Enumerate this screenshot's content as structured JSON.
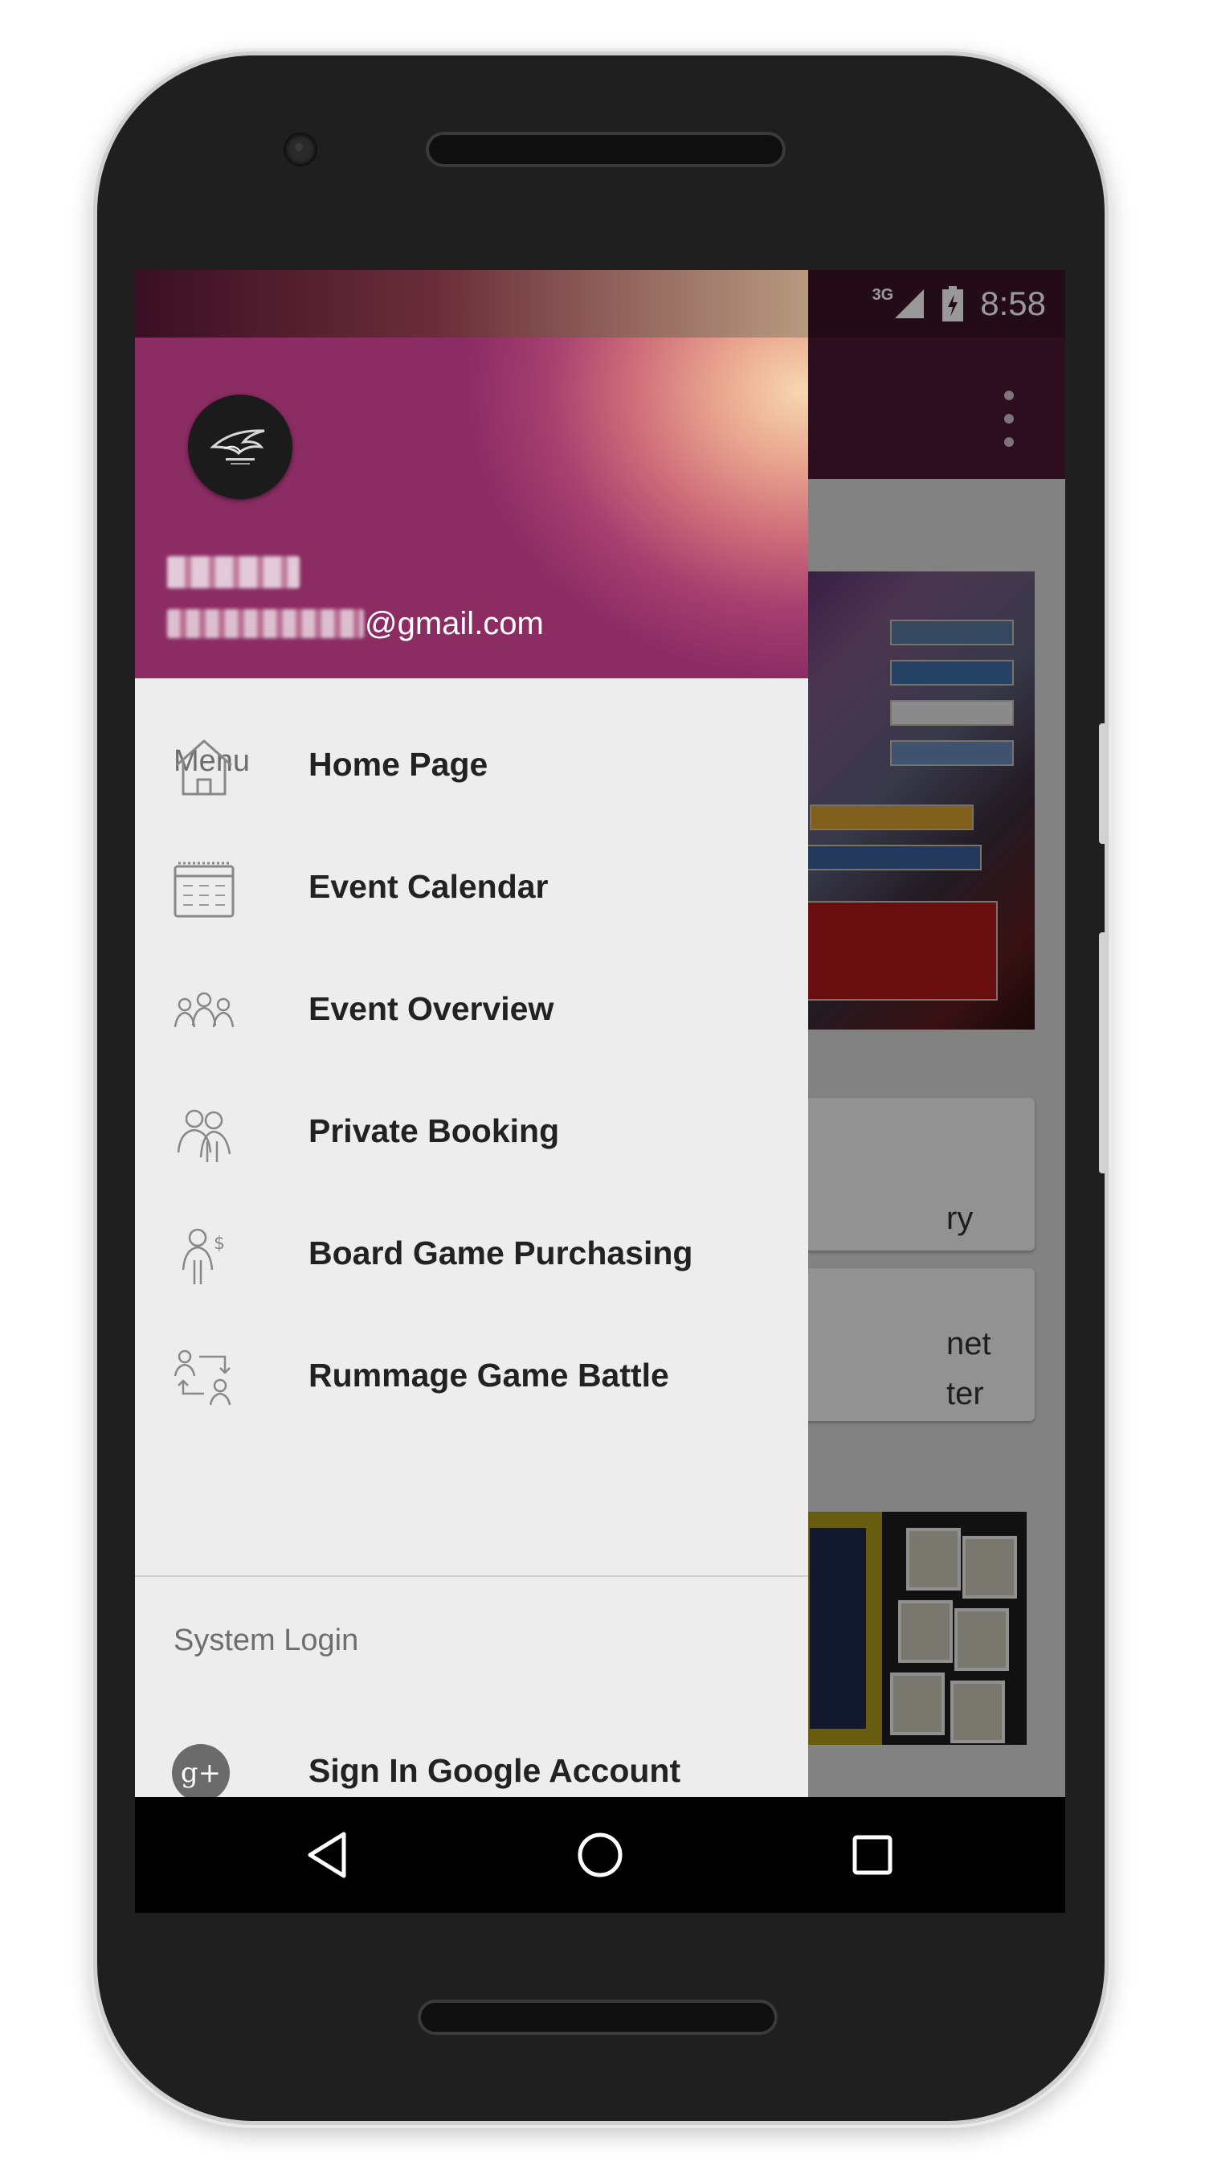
{
  "status_bar": {
    "network": "3G",
    "time": "8:58"
  },
  "content_preview": {
    "card1_text": "ry",
    "card2_line1": "net",
    "card2_line2": "ter"
  },
  "drawer": {
    "email_domain": "@gmail.com",
    "menu_section": "Menu",
    "menu_items": [
      {
        "label": "Home Page",
        "icon": "home-icon"
      },
      {
        "label": "Event Calendar",
        "icon": "calendar-icon"
      },
      {
        "label": "Event Overview",
        "icon": "group-icon"
      },
      {
        "label": "Private Booking",
        "icon": "people-icon"
      },
      {
        "label": "Board Game Purchasing",
        "icon": "purchase-icon"
      },
      {
        "label": "Rummage Game Battle",
        "icon": "swap-icon"
      }
    ],
    "login_section": "System Login",
    "login_item": {
      "label": "Sign In Google Account",
      "icon": "google-plus-icon",
      "glyph": "g+"
    }
  },
  "colors": {
    "status_bar": "#3c1329",
    "toolbar": "#4a1833",
    "drawer_bg": "#ededed",
    "nav_bar": "#000000"
  }
}
